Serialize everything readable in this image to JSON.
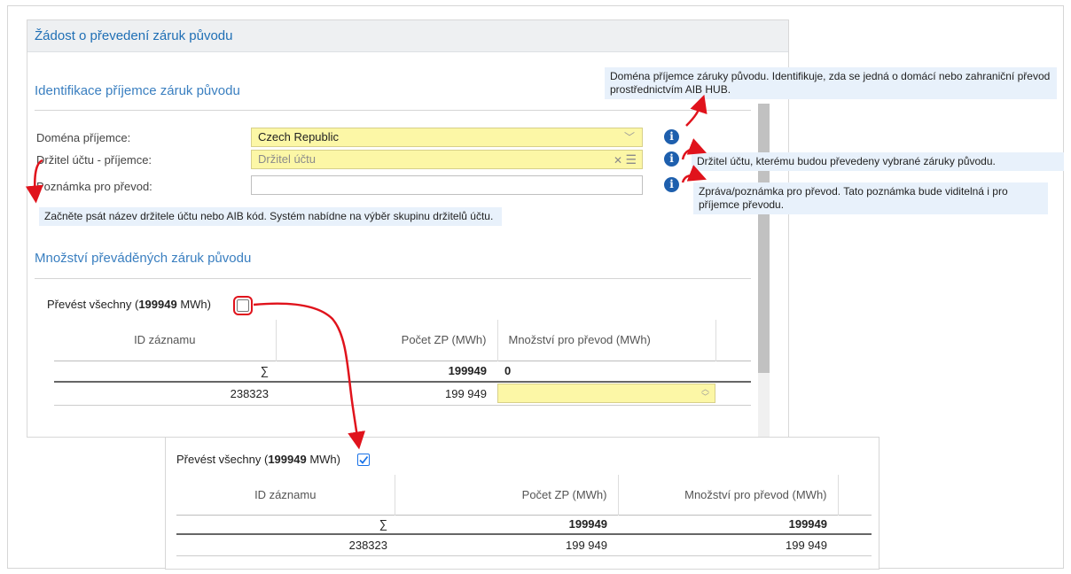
{
  "panel": {
    "title": "Žádost o převedení záruk původu"
  },
  "identification": {
    "title": "Identifikace příjemce záruk původu",
    "domain_label": "Doména příjemce:",
    "domain_value": "Czech Republic",
    "holder_label": "Držitel účtu - příjemce:",
    "holder_placeholder": "Držitel účtu",
    "note_label": "Poznámka pro převod:",
    "note_value": ""
  },
  "quantity": {
    "title": "Množství převáděných záruk původu",
    "transfer_all_prefix": "Převést všechny (",
    "transfer_all_value": "199949",
    "transfer_all_suffix": " MWh)",
    "columns": [
      "ID záznamu",
      "Počet ZP (MWh)",
      "Množství pro převod (MWh)"
    ],
    "sum_symbol": "∑",
    "sum_count": "199949",
    "sum_transfer": "0",
    "row": {
      "id": "238323",
      "count": "199 949",
      "transfer": ""
    }
  },
  "inset": {
    "transfer_all_prefix": "Převést všechny (",
    "transfer_all_value": "199949",
    "transfer_all_suffix": " MWh)",
    "columns": [
      "ID záznamu",
      "Počet ZP (MWh)",
      "Množství pro převod (MWh)"
    ],
    "sum_symbol": "∑",
    "sum_count": "199949",
    "sum_transfer": "199949",
    "row": {
      "id": "238323",
      "count": "199 949",
      "transfer": "199 949"
    }
  },
  "tooltips": {
    "domain": "Doména příjemce záruky původu. Identifikuje, zda se jedná o domácí nebo zahraniční převod prostřednictvím AIB HUB.",
    "holder": "Držitel účtu, kterému budou převedeny vybrané záruky původu.",
    "note": "Zpráva/poznámka pro převod. Tato poznámka bude viditelná i pro příjemce převodu.",
    "typing": "Začněte psát název držitele účtu nebo AIB kód. Systém nabídne na výběr skupinu držitelů účtu."
  },
  "icons": {
    "info": "info-icon",
    "dropdown": "chevron-down-icon",
    "clear": "clear-icon",
    "list": "list-icon",
    "spinner": "spinner-icon",
    "checkmark": "checkmark-icon"
  },
  "colors": {
    "accent": "#3a7fc0",
    "field_highlight": "#fcf7a6",
    "annotation": "#e0131c",
    "tooltip_bg": "#e8f1fb",
    "info_icon": "#1e5fad"
  }
}
